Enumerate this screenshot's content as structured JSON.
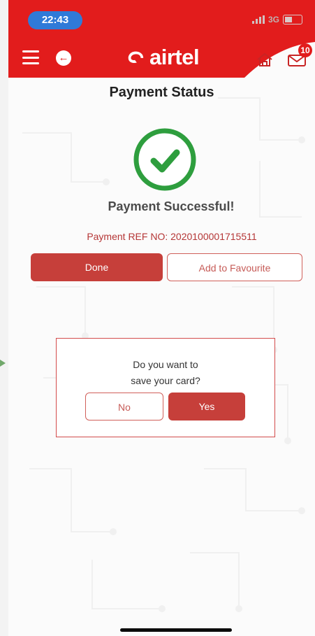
{
  "status_bar": {
    "time": "22:43",
    "network": "3G"
  },
  "header": {
    "brand": "airtel",
    "notification_count": "10"
  },
  "page": {
    "title": "Payment Status",
    "success_message": "Payment Successful!",
    "reference_text": "Payment REF NO: 2020100001715511"
  },
  "actions": {
    "done_label": "Done",
    "favourite_label": "Add to Favourite"
  },
  "save_card_prompt": {
    "line1": "Do you want to",
    "line2": "save your card?",
    "no_label": "No",
    "yes_label": "Yes"
  },
  "colors": {
    "brand_red": "#e21c1c",
    "success_green": "#2e9e3e",
    "button_red": "#c63f3a"
  },
  "icons": {
    "menu": "hamburger-menu-icon",
    "back": "back-arrow-icon",
    "home": "home-icon",
    "mail": "mail-icon",
    "success": "check-circle-icon"
  }
}
